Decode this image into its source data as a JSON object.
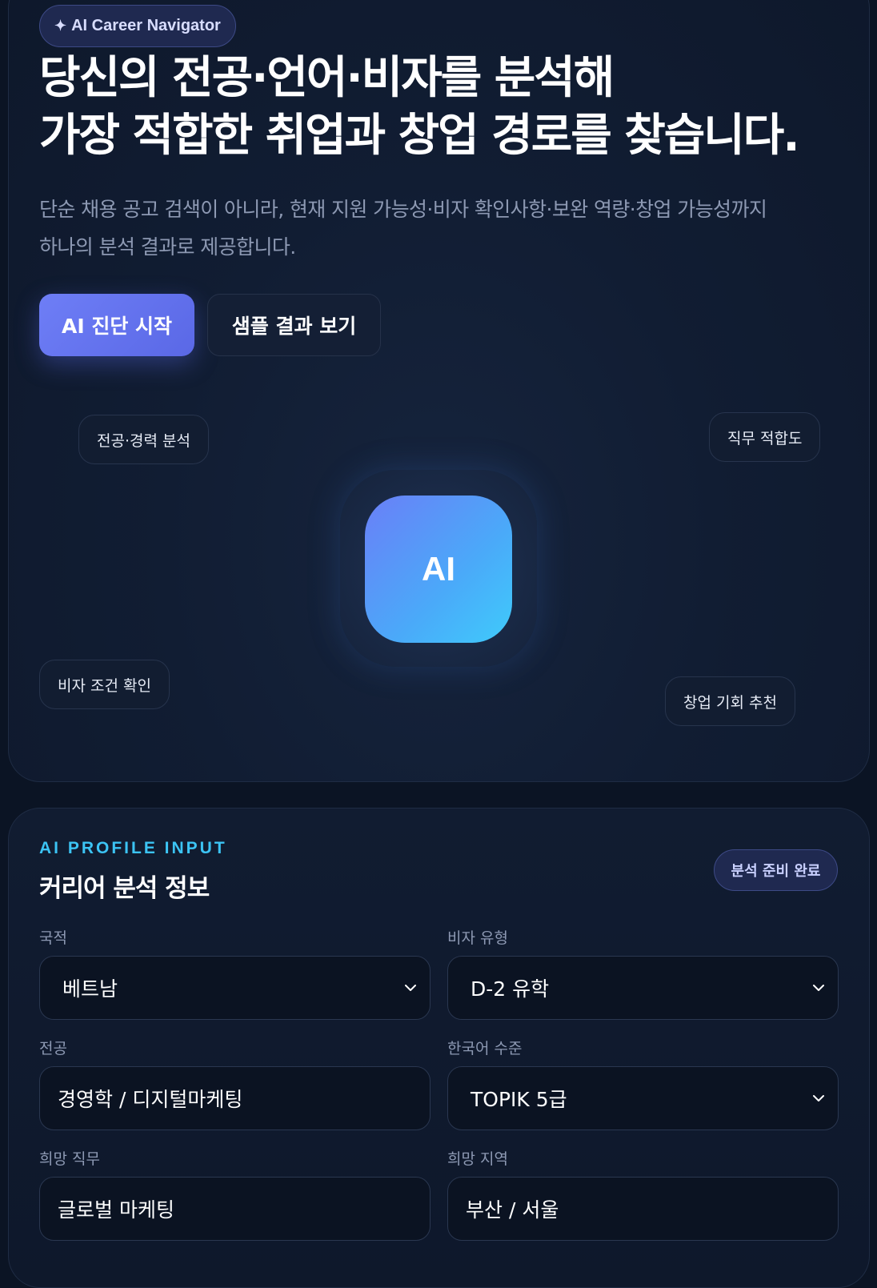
{
  "hero": {
    "badge_icon": "sparkle-icon",
    "badge": "AI Career Navigator",
    "headline_line1": "당신의 전공·언어·비자를 분석해",
    "headline_line2": "가장 적합한 취업과 창업 경로를 찾습니다.",
    "subtext_line1": "단순 채용 공고 검색이 아니라, 현재 지원 가능성·비자 확인사항·보완 역량·창업 가능성까지",
    "subtext_line2": "하나의 분석 결과로 제공합니다.",
    "primary_button": "AI 진단 시작",
    "secondary_button": "샘플 결과 보기",
    "chips": {
      "major": "전공·경력 분석",
      "fit": "직무 적합도",
      "visa": "비자 조건 확인",
      "startup": "창업 기회 추천"
    },
    "ai_label": "AI"
  },
  "profile": {
    "eyebrow": "AI PROFILE INPUT",
    "title": "커리어 분석 정보",
    "status": "분석 준비 완료",
    "fields": {
      "nationality": {
        "label": "국적",
        "value": "베트남"
      },
      "visa": {
        "label": "비자 유형",
        "value": "D-2 유학"
      },
      "major": {
        "label": "전공",
        "value": "경영학 / 디지털마케팅"
      },
      "korean": {
        "label": "한국어 수준",
        "value": "TOPIK 5급"
      },
      "job": {
        "label": "희망 직무",
        "value": "글로벌 마케팅"
      },
      "region": {
        "label": "희망 지역",
        "value": "부산 / 서울"
      }
    }
  },
  "colors": {
    "background": "#0b1424",
    "accent": "#5f6ef0",
    "eyebrow": "#3cc4f4",
    "muted_text": "#8d99b3"
  }
}
